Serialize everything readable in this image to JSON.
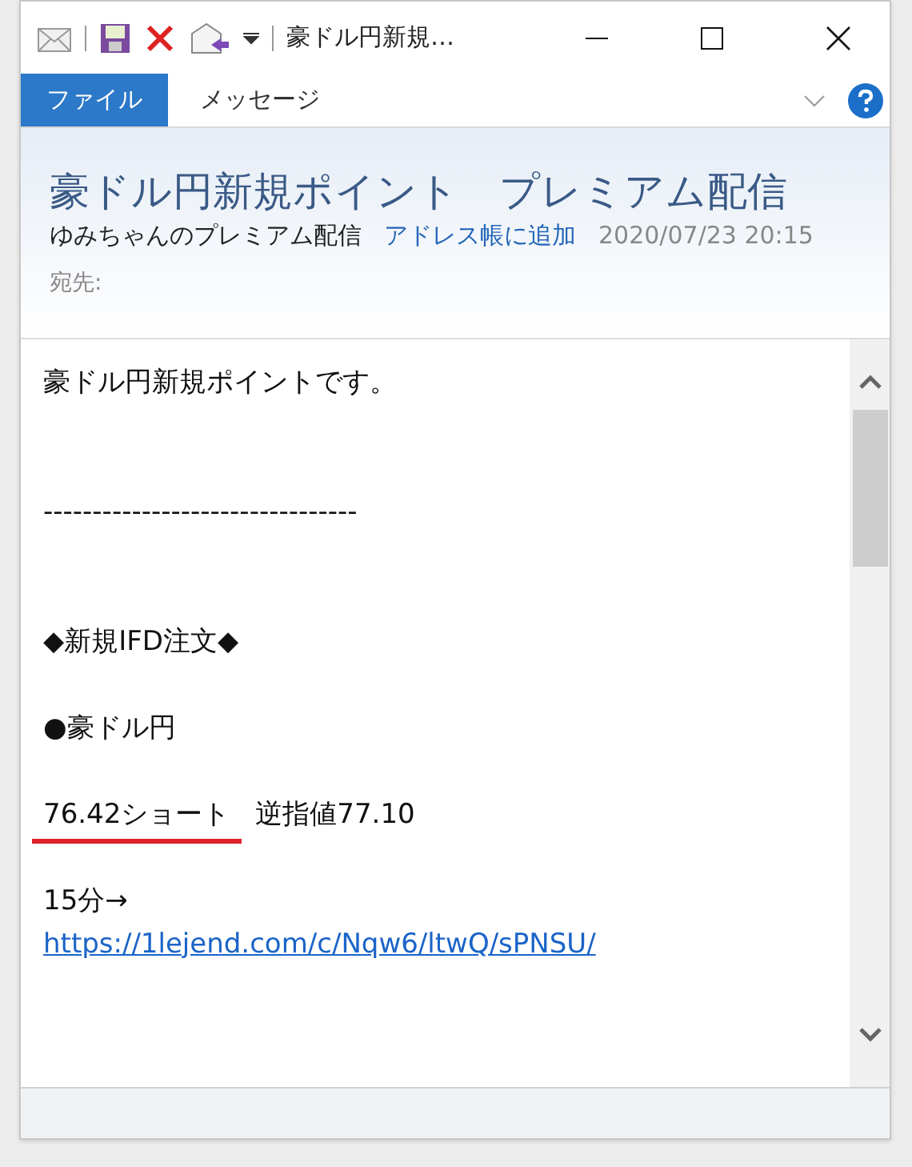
{
  "window": {
    "title": "豪ドル円新規…"
  },
  "ribbon": {
    "tabs": [
      {
        "label": "ファイル",
        "selected": true
      },
      {
        "label": "メッセージ",
        "selected": false
      }
    ]
  },
  "message": {
    "subject": "豪ドル円新規ポイント　プレミアム配信",
    "sender": "ゆみちゃんのプレミアム配信",
    "add_contact": "アドレス帳に追加",
    "date": "2020/07/23 20:15",
    "to_label": "宛先:"
  },
  "body": [
    {
      "kind": "text",
      "segments": [
        {
          "text": "豪ドル円新規ポイントです。",
          "underlined": false
        }
      ]
    },
    {
      "kind": "blank"
    },
    {
      "kind": "blank"
    },
    {
      "kind": "text",
      "segments": [
        {
          "text": "--------------------------------",
          "underlined": false
        }
      ]
    },
    {
      "kind": "blank"
    },
    {
      "kind": "blank"
    },
    {
      "kind": "text",
      "segments": [
        {
          "text": "◆新規IFD注文◆",
          "underlined": false
        }
      ]
    },
    {
      "kind": "blank"
    },
    {
      "kind": "text",
      "segments": [
        {
          "text": "●豪ドル円",
          "underlined": false
        }
      ]
    },
    {
      "kind": "blank"
    },
    {
      "kind": "text",
      "segments": [
        {
          "text": "76.42ショート",
          "underlined": true
        },
        {
          "text": "逆指値77.10",
          "underlined": false
        }
      ]
    },
    {
      "kind": "blank"
    },
    {
      "kind": "text",
      "segments": [
        {
          "text": "15分→",
          "underlined": false
        }
      ]
    },
    {
      "kind": "link",
      "text": "https://1lejend.com/c/Nqw6/ltwQ/sPNSU/"
    }
  ]
}
